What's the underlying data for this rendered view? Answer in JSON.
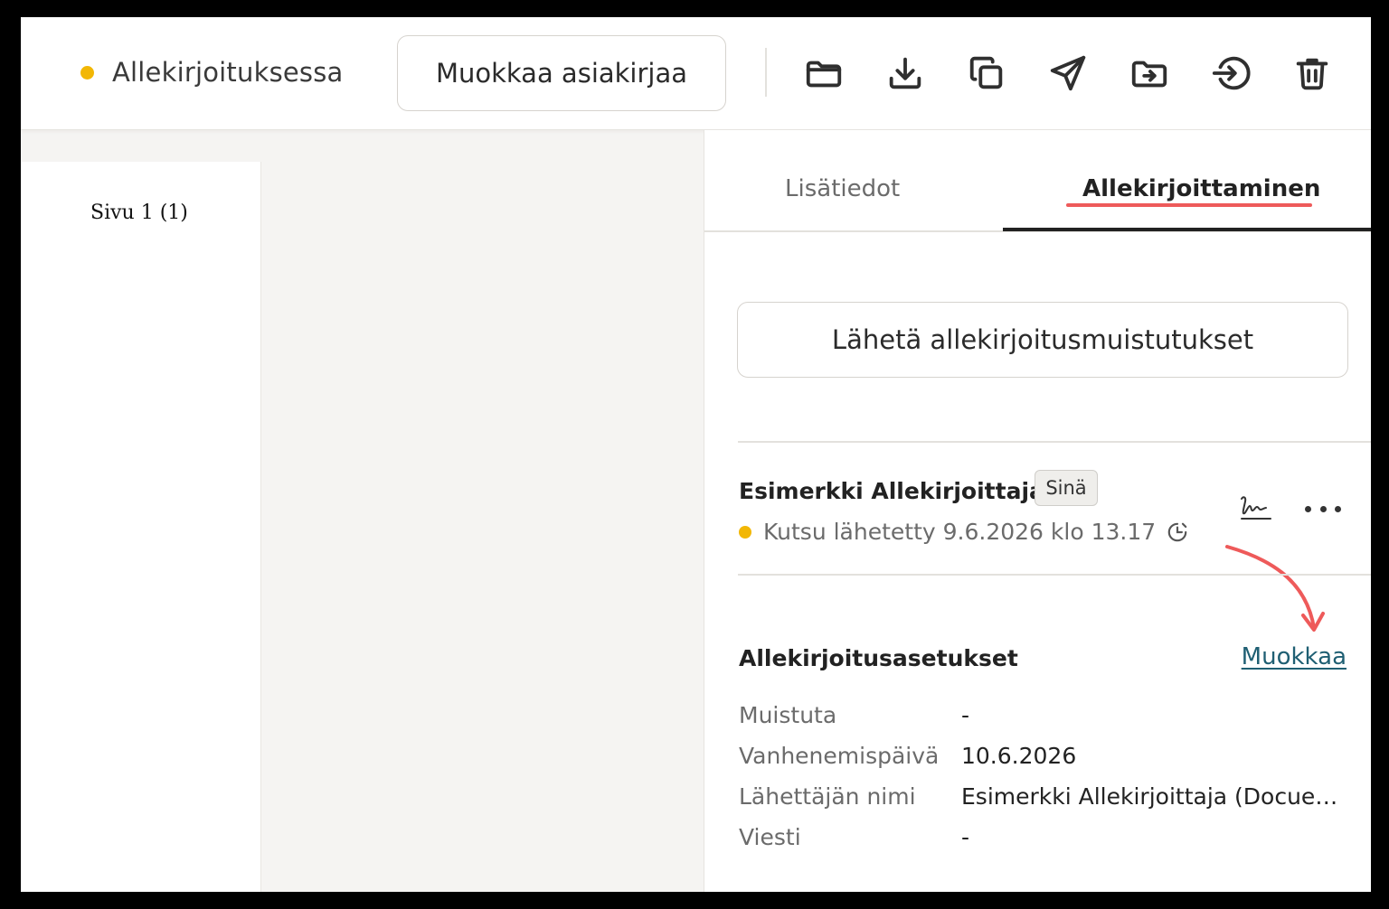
{
  "toolbar": {
    "status_label": "Allekirjoituksessa",
    "status_color": "#f2b705",
    "edit_document_label": "Muokkaa asiakirjaa",
    "icons": [
      "folder-icon",
      "download-icon",
      "copy-icon",
      "send-icon",
      "move-to-folder-icon",
      "sign-in-icon",
      "trash-icon"
    ]
  },
  "document": {
    "page_label": "Sivu  1 (1)"
  },
  "panel": {
    "tabs": {
      "info_label": "Lisätiedot",
      "signing_label": "Allekirjoittaminen"
    },
    "highlight_color": "#ee5a5a",
    "send_reminders_label": "Lähetä allekirjoitusmuistutukset",
    "signer": {
      "name": "Esimerkki Allekirjoittaja",
      "badge": "Sinä",
      "invite_status": "Kutsu lähetetty 9.6.2026 klo 13.17"
    },
    "settings": {
      "title": "Allekirjoitusasetukset",
      "edit_label": "Muokkaa",
      "rows": [
        {
          "label": "Muistuta",
          "value": "-"
        },
        {
          "label": "Vanhenemispäivä",
          "value": "10.6.2026"
        },
        {
          "label": "Lähettäjän nimi",
          "value": "Esimerkki Allekirjoittaja (Docue…"
        },
        {
          "label": "Viesti",
          "value": "-"
        }
      ]
    }
  }
}
